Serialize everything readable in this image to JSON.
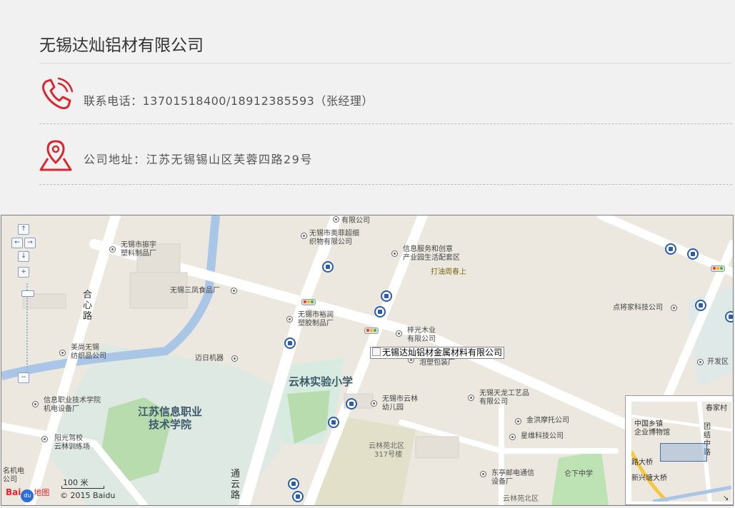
{
  "company": {
    "name": "无锡达灿铝材有限公司"
  },
  "contact": {
    "phone_text": "联系电话：13701518400/18912385593（张经理）",
    "address_text": "公司地址：江苏无锡锡山区芙蓉四路29号",
    "phone_icon": "phone-icon",
    "location_icon": "location-pin-icon",
    "accent_color": "#d7282f"
  },
  "map": {
    "marker_label": "无锡达灿铝材金属材料有限公司",
    "pois": {
      "p1": "有限公司",
      "p2a": "无锡市奥菲超细",
      "p2b": "织物有限公司",
      "p3a": "无锡市振宇",
      "p3b": "塑料制品厂",
      "p4a": "信息服务和创意",
      "p4b": "产业园生活配套区",
      "p5": "打油周春上",
      "p6": "无锡三凤食品厂",
      "p7a": "无锡市裕润",
      "p7b": "塑胶制品厂",
      "p8a": "梓光木业",
      "p8b": "有限公司",
      "p9": "点将家科技公司",
      "p10a": "美尚无锡",
      "p10b": "纺织品公司",
      "p11": "迈日机器",
      "p12": "泡塑包装厂",
      "p13": "开发区",
      "p14a": "信息职业技术学院",
      "p14b": "机电设备厂",
      "p15a": "无锡市云林",
      "p15b": "幼儿园",
      "p16a": "无锡天龙工艺品",
      "p16b": "有限公司",
      "p17": "金洪摩托公司",
      "p18a": "阳光驾校",
      "p18b": "云林训练场",
      "p19": "星维科技公司",
      "p20a": "云林苑北区",
      "p20b": "317号楼",
      "p21": "名机电",
      "p21b": "公司",
      "p22a": "东亭邮电通信",
      "p22b": "设备厂",
      "p23": "仑下中学",
      "p24": "云林苑北区"
    },
    "roads": {
      "r1": "合心路",
      "r2": "通云路"
    },
    "areas": {
      "a1": "江苏信息职业\n技术学院",
      "a2": "云林实验小学"
    },
    "scale_text": "100 米",
    "copyright": "© 2015 Baidu",
    "logo_bai": "Bai",
    "logo_du": "du",
    "logo_ditu": "地图",
    "overview": {
      "o1": "春家村",
      "o2a": "中国乡镇",
      "o2b": "企业博物馆",
      "o3": "路大桥",
      "o4": "新兴塘大桥",
      "o5": "团结中路"
    },
    "nav": {
      "up": "↑",
      "left": "←",
      "right": "→",
      "down": "↓",
      "zoom_in": "+",
      "zoom_out": "−"
    }
  }
}
